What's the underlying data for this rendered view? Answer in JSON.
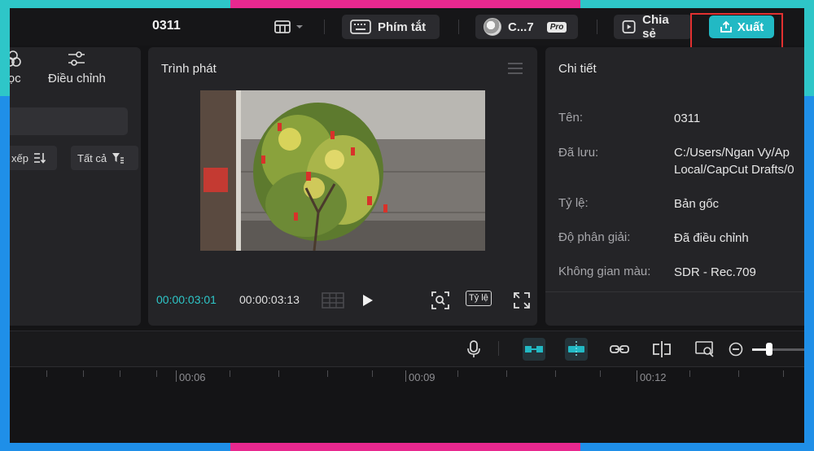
{
  "app": {
    "project_title": "0311"
  },
  "topbar": {
    "shortcut_label": "Phím tắt",
    "account_label": "C...7",
    "pro_badge": "Pro",
    "share_label": "Chia sẻ",
    "export_label": "Xuất"
  },
  "left_panel": {
    "tabs": [
      {
        "label": "lọc",
        "icon": "filter-circles-icon"
      },
      {
        "label": "Điều chỉnh",
        "icon": "sliders-icon"
      }
    ],
    "sort_label": "xếp",
    "filter_all_label": "Tất cả"
  },
  "player": {
    "title": "Trình phát",
    "current_time": "00:00:03:01",
    "total_time": "00:00:03:13",
    "ratio_label": "Tỷ lệ"
  },
  "details": {
    "title": "Chi tiết",
    "rows": [
      {
        "label": "Tên:",
        "value": "0311"
      },
      {
        "label": "Đã lưu:",
        "value": "C:/Users/Ngan Vy/Ap",
        "value2": "Local/CapCut Drafts/0"
      },
      {
        "label": "Tỷ lệ:",
        "value": "Bản gốc"
      },
      {
        "label": "Độ phân giải:",
        "value": "Đã điều chỉnh"
      },
      {
        "label": "Không gian màu:",
        "value": "SDR - Rec.709"
      }
    ]
  },
  "timeline": {
    "ruler_labels": [
      "00:06",
      "00:09",
      "00:12"
    ]
  },
  "colors": {
    "accent": "#22b9c4",
    "highlight": "#e23030",
    "time_current": "#2ec6c8"
  }
}
